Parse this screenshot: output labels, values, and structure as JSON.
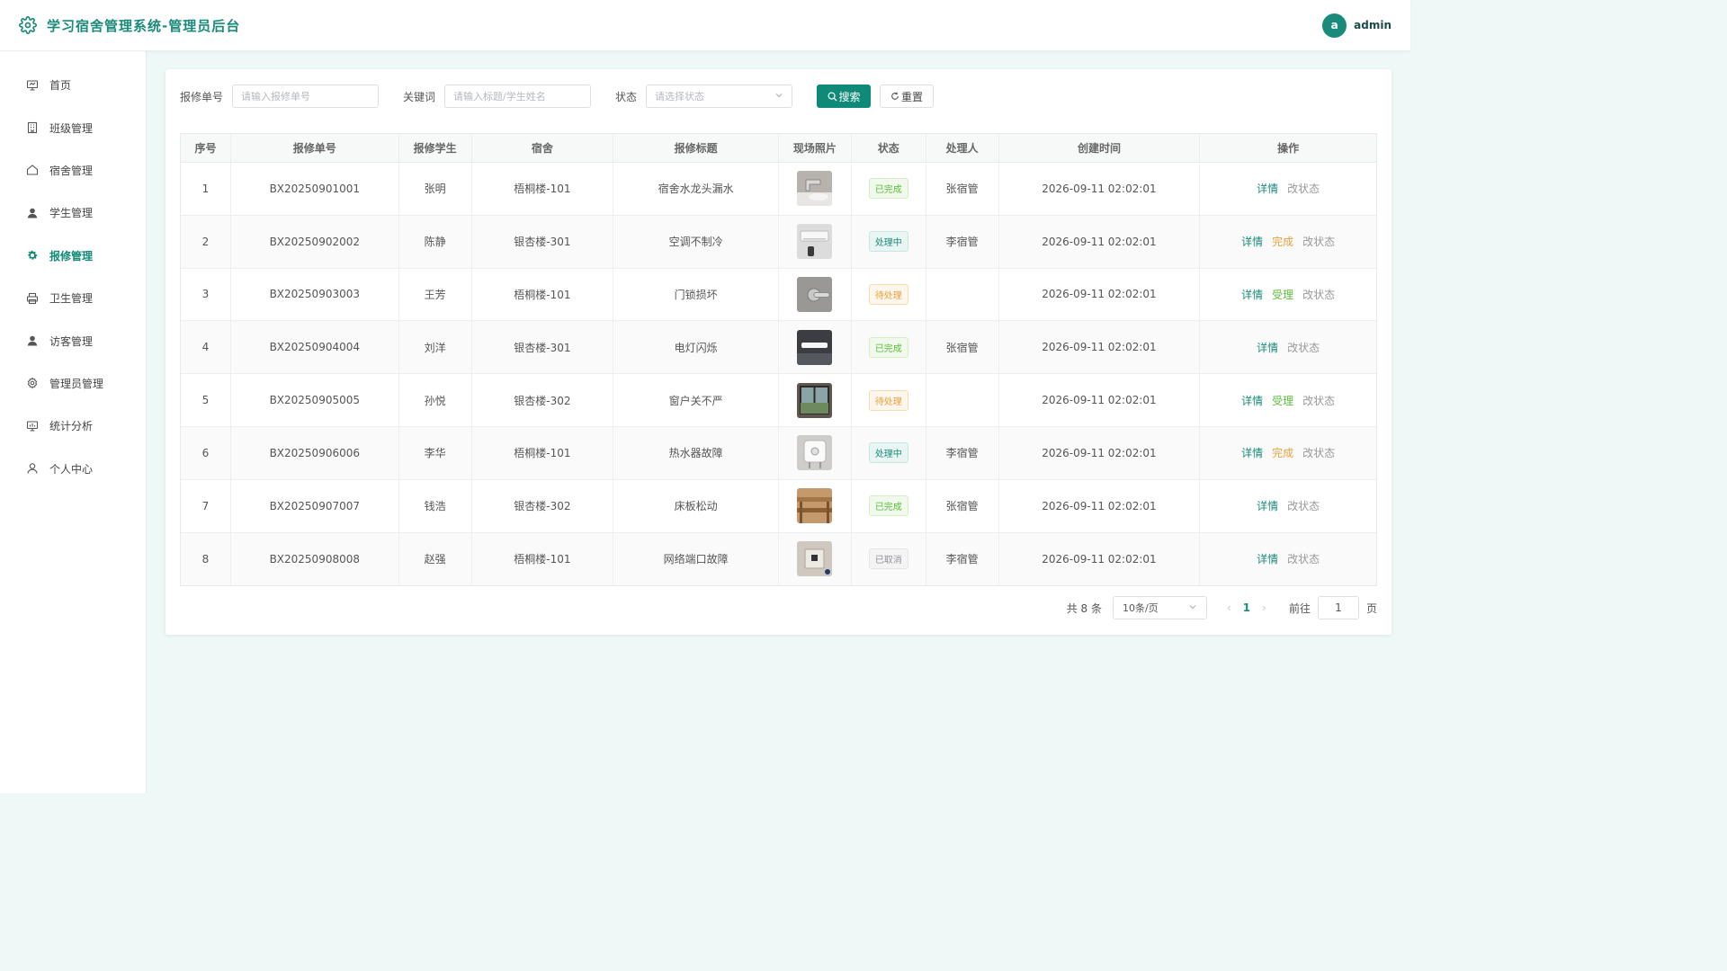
{
  "header": {
    "title": "学习宿舍管理系统-管理员后台",
    "avatar_letter": "a",
    "user_name": "admin"
  },
  "sidebar": {
    "items": [
      {
        "label": "首页",
        "icon": "monitor-icon",
        "active": false
      },
      {
        "label": "班级管理",
        "icon": "building-icon",
        "active": false
      },
      {
        "label": "宿舍管理",
        "icon": "house-icon",
        "active": false
      },
      {
        "label": "学生管理",
        "icon": "user-icon",
        "active": false
      },
      {
        "label": "报修管理",
        "icon": "gear-icon",
        "active": true
      },
      {
        "label": "卫生管理",
        "icon": "printer-icon",
        "active": false
      },
      {
        "label": "访客管理",
        "icon": "user-icon",
        "active": false
      },
      {
        "label": "管理员管理",
        "icon": "gear-outline-icon",
        "active": false
      },
      {
        "label": "统计分析",
        "icon": "chart-monitor-icon",
        "active": false
      },
      {
        "label": "个人中心",
        "icon": "user-outline-icon",
        "active": false
      }
    ]
  },
  "filters": {
    "repair_no_label": "报修单号",
    "repair_no_placeholder": "请输入报修单号",
    "keyword_label": "关键词",
    "keyword_placeholder": "请输入标题/学生姓名",
    "status_label": "状态",
    "status_placeholder": "请选择状态",
    "search_label": "搜索",
    "reset_label": "重置"
  },
  "table": {
    "columns": [
      "序号",
      "报修单号",
      "报修学生",
      "宿舍",
      "报修标题",
      "现场照片",
      "状态",
      "处理人",
      "创建时间",
      "操作"
    ],
    "rows": [
      {
        "idx": "1",
        "no": "BX20250901001",
        "student": "张明",
        "dorm": "梧桐楼-101",
        "title": "宿舍水龙头漏水",
        "photo": "faucet",
        "status": "已完成",
        "status_type": "done",
        "handler": "张宿管",
        "created": "2026-09-11 02:02:01",
        "ops": [
          "详情",
          "改状态"
        ]
      },
      {
        "idx": "2",
        "no": "BX20250902002",
        "student": "陈静",
        "dorm": "银杏楼-301",
        "title": "空调不制冷",
        "photo": "aircon",
        "status": "处理中",
        "status_type": "doing",
        "handler": "李宿管",
        "created": "2026-09-11 02:02:01",
        "ops": [
          "详情",
          "完成",
          "改状态"
        ]
      },
      {
        "idx": "3",
        "no": "BX20250903003",
        "student": "王芳",
        "dorm": "梧桐楼-101",
        "title": "门锁损坏",
        "photo": "doorlock",
        "status": "待处理",
        "status_type": "wait",
        "handler": "",
        "created": "2026-09-11 02:02:01",
        "ops": [
          "详情",
          "受理",
          "改状态"
        ]
      },
      {
        "idx": "4",
        "no": "BX20250904004",
        "student": "刘洋",
        "dorm": "银杏楼-301",
        "title": "电灯闪烁",
        "photo": "lamp",
        "status": "已完成",
        "status_type": "done",
        "handler": "张宿管",
        "created": "2026-09-11 02:02:01",
        "ops": [
          "详情",
          "改状态"
        ]
      },
      {
        "idx": "5",
        "no": "BX20250905005",
        "student": "孙悦",
        "dorm": "银杏楼-302",
        "title": "窗户关不严",
        "photo": "window",
        "status": "待处理",
        "status_type": "wait",
        "handler": "",
        "created": "2026-09-11 02:02:01",
        "ops": [
          "详情",
          "受理",
          "改状态"
        ]
      },
      {
        "idx": "6",
        "no": "BX20250906006",
        "student": "李华",
        "dorm": "梧桐楼-101",
        "title": "热水器故障",
        "photo": "heater",
        "status": "处理中",
        "status_type": "doing",
        "handler": "李宿管",
        "created": "2026-09-11 02:02:01",
        "ops": [
          "详情",
          "完成",
          "改状态"
        ]
      },
      {
        "idx": "7",
        "no": "BX20250907007",
        "student": "钱浩",
        "dorm": "银杏楼-302",
        "title": "床板松动",
        "photo": "bed",
        "status": "已完成",
        "status_type": "done",
        "handler": "张宿管",
        "created": "2026-09-11 02:02:01",
        "ops": [
          "详情",
          "改状态"
        ]
      },
      {
        "idx": "8",
        "no": "BX20250908008",
        "student": "赵强",
        "dorm": "梧桐楼-101",
        "title": "网络端口故障",
        "photo": "netport",
        "status": "已取消",
        "status_type": "cancel",
        "handler": "李宿管",
        "created": "2026-09-11 02:02:01",
        "ops": [
          "详情",
          "改状态"
        ]
      }
    ]
  },
  "pagination": {
    "total": "共 8 条",
    "page_size": "10条/页",
    "current": "1",
    "goto_label": "前往",
    "goto_value": "1",
    "page_suffix": "页"
  },
  "colors": {
    "accent": "#0f8a78",
    "background": "#eef8f6"
  }
}
